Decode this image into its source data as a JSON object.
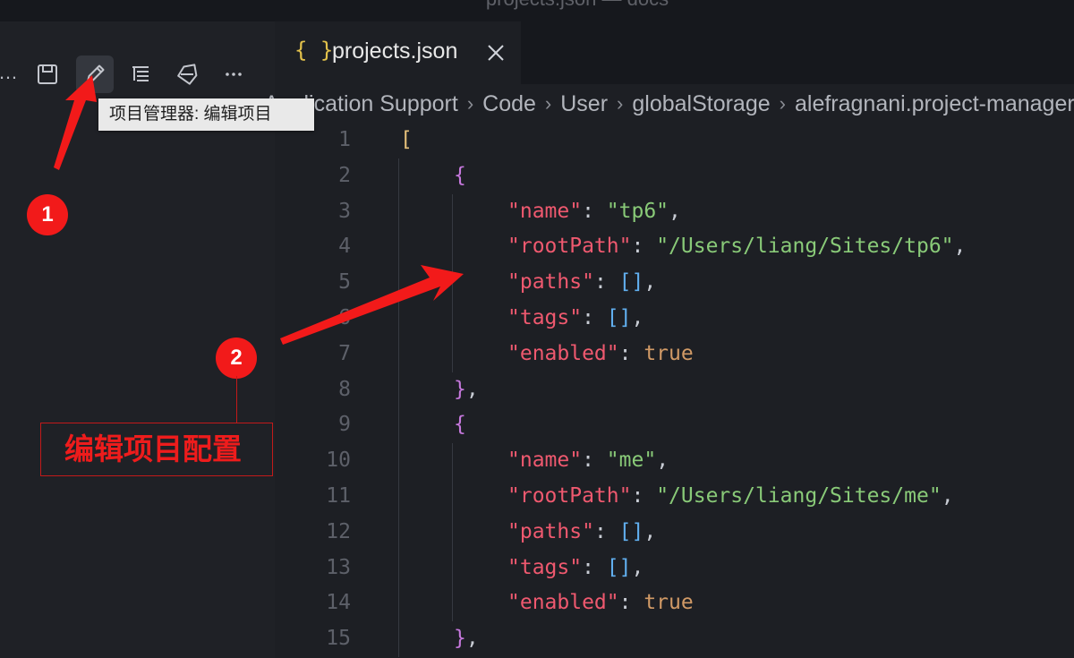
{
  "window": {
    "title": "projects.json — docs"
  },
  "sidebar": {
    "ellipsis": "…",
    "toolbar": [
      {
        "name": "save-icon",
        "active": false
      },
      {
        "name": "pencil-icon",
        "active": true
      },
      {
        "name": "list-tree-icon",
        "active": false
      },
      {
        "name": "tag-icon",
        "active": false
      },
      {
        "name": "more-icon",
        "active": false
      }
    ],
    "tooltip": "项目管理器: 编辑项目"
  },
  "annotations": {
    "badge1": "1",
    "badge2": "2",
    "callout": "编辑项目配置",
    "arrow_color": "#f21a1a"
  },
  "editor": {
    "tab": {
      "icon": "{ }",
      "label": "projects.json",
      "close_icon": "close-icon"
    },
    "breadcrumb": [
      "Application Support",
      "Code",
      "User",
      "globalStorage",
      "alefragnani.project-manager"
    ],
    "lines": [
      {
        "n": "1",
        "indent": 0,
        "tokens": [
          [
            "[",
            "b1"
          ]
        ]
      },
      {
        "n": "2",
        "indent": 1,
        "tokens": [
          [
            "{",
            "b2"
          ]
        ]
      },
      {
        "n": "3",
        "indent": 2,
        "tokens": [
          [
            "\"name\"",
            "key"
          ],
          [
            ": ",
            "punc"
          ],
          [
            "\"tp6\"",
            "str"
          ],
          [
            ",",
            "punc"
          ]
        ]
      },
      {
        "n": "4",
        "indent": 2,
        "tokens": [
          [
            "\"rootPath\"",
            "key"
          ],
          [
            ": ",
            "punc"
          ],
          [
            "\"/Users/liang/Sites/tp6\"",
            "str"
          ],
          [
            ",",
            "punc"
          ]
        ]
      },
      {
        "n": "5",
        "indent": 2,
        "tokens": [
          [
            "\"paths\"",
            "key"
          ],
          [
            ": ",
            "punc"
          ],
          [
            "[]",
            "b3"
          ],
          [
            ",",
            "punc"
          ]
        ]
      },
      {
        "n": "6",
        "indent": 2,
        "tokens": [
          [
            "\"tags\"",
            "key"
          ],
          [
            ": ",
            "punc"
          ],
          [
            "[]",
            "b3"
          ],
          [
            ",",
            "punc"
          ]
        ]
      },
      {
        "n": "7",
        "indent": 2,
        "tokens": [
          [
            "\"enabled\"",
            "key"
          ],
          [
            ": ",
            "punc"
          ],
          [
            "true",
            "bool"
          ]
        ]
      },
      {
        "n": "8",
        "indent": 1,
        "tokens": [
          [
            "}",
            "b2"
          ],
          [
            ",",
            "punc"
          ]
        ]
      },
      {
        "n": "9",
        "indent": 1,
        "tokens": [
          [
            "{",
            "b2"
          ]
        ]
      },
      {
        "n": "10",
        "indent": 2,
        "tokens": [
          [
            "\"name\"",
            "key"
          ],
          [
            ": ",
            "punc"
          ],
          [
            "\"me\"",
            "str"
          ],
          [
            ",",
            "punc"
          ]
        ]
      },
      {
        "n": "11",
        "indent": 2,
        "tokens": [
          [
            "\"rootPath\"",
            "key"
          ],
          [
            ": ",
            "punc"
          ],
          [
            "\"/Users/liang/Sites/me\"",
            "str"
          ],
          [
            ",",
            "punc"
          ]
        ]
      },
      {
        "n": "12",
        "indent": 2,
        "tokens": [
          [
            "\"paths\"",
            "key"
          ],
          [
            ": ",
            "punc"
          ],
          [
            "[]",
            "b3"
          ],
          [
            ",",
            "punc"
          ]
        ]
      },
      {
        "n": "13",
        "indent": 2,
        "tokens": [
          [
            "\"tags\"",
            "key"
          ],
          [
            ": ",
            "punc"
          ],
          [
            "[]",
            "b3"
          ],
          [
            ",",
            "punc"
          ]
        ]
      },
      {
        "n": "14",
        "indent": 2,
        "tokens": [
          [
            "\"enabled\"",
            "key"
          ],
          [
            ": ",
            "punc"
          ],
          [
            "true",
            "bool"
          ]
        ]
      },
      {
        "n": "15",
        "indent": 1,
        "tokens": [
          [
            "}",
            "b2"
          ],
          [
            ",",
            "punc"
          ]
        ]
      }
    ]
  }
}
